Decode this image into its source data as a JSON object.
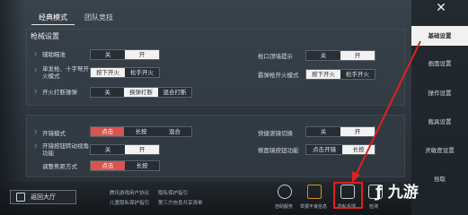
{
  "tabs": [
    "经典模式",
    "团队竞技"
  ],
  "sections": {
    "gun_settings": "枪械设置"
  },
  "rows": {
    "assist_aim": {
      "label": "辅助瞄准",
      "options": [
        "关",
        "开"
      ]
    },
    "single_fire": {
      "label": "单发枪、十字弩开火模式",
      "options": [
        "按下开火",
        "松手开火"
      ]
    },
    "open_fire_scope": {
      "label": "开火打断操弹",
      "options": [
        "关",
        "换弹打断",
        "混合打断"
      ]
    },
    "muzzle_hint": {
      "label": "枪口顶墙提示",
      "options": [
        "关",
        "开"
      ]
    },
    "sniper_fire": {
      "label": "霰弹枪开火模式",
      "options": [
        "按下开火",
        "松手开火"
      ]
    },
    "scope_mode": {
      "label": "开镜模式",
      "options": [
        "点击",
        "长按",
        "混合"
      ]
    },
    "scope_gyro": {
      "label": "开镜按钮转动视角功能",
      "options": [
        "关",
        "开"
      ]
    },
    "adjust_focus": {
      "label": "调整焦距方式",
      "options": [
        "点击",
        "长按"
      ]
    },
    "quick_scope": {
      "label": "快捷滚镜切换",
      "options": [
        "关",
        "开"
      ]
    },
    "side_scope": {
      "label": "侧面镜按钮功能",
      "options": [
        "点击开镜",
        "长按"
      ]
    }
  },
  "right_menu": [
    "基础设置",
    "画面设置",
    "操作设置",
    "载具设置",
    "灵敏度设置",
    "拾取"
  ],
  "bottom": {
    "back": "返回大厅",
    "links": [
      "腾讯游戏用户协议",
      "隐私保护指引",
      "儿童隐私保护指引",
      "第三方信息共享清单"
    ],
    "icons": [
      "自助服务",
      "举报不良信息",
      "隐私反馈",
      "检测"
    ]
  },
  "watermark": "九游",
  "annotation_color": "#e02020"
}
